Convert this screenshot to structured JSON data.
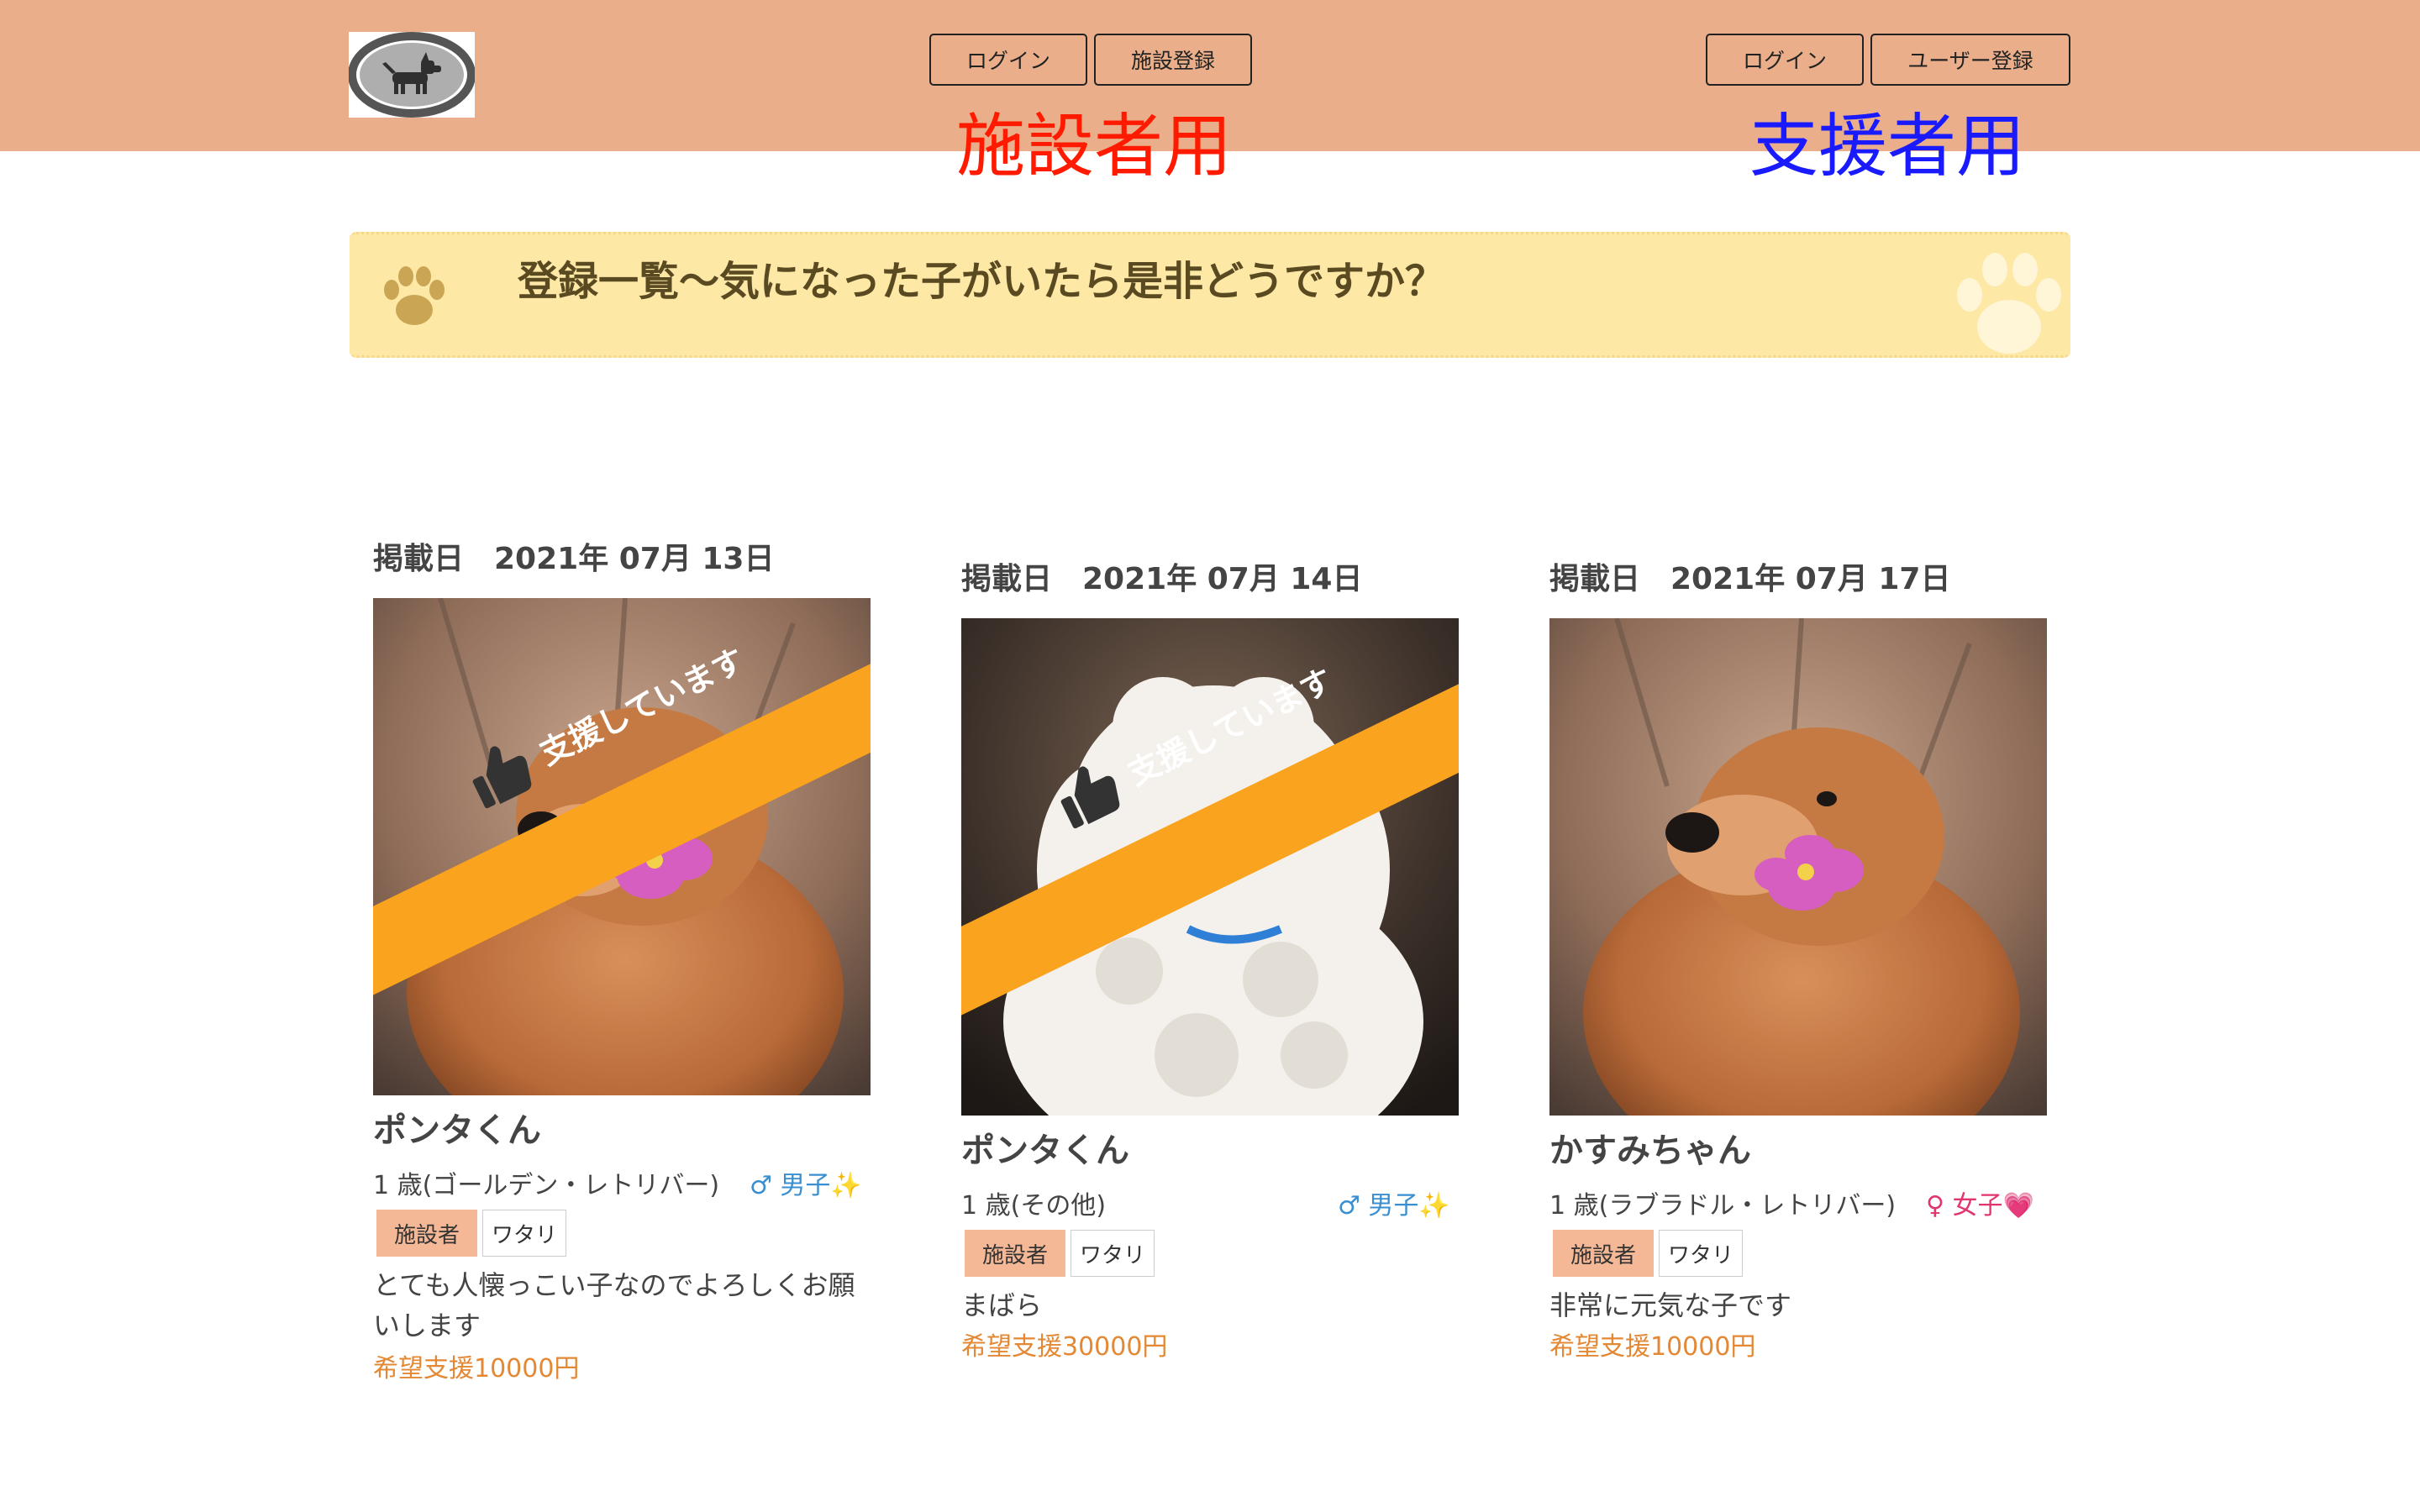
{
  "header": {
    "logo_icon": "dog-icon",
    "facility": {
      "login_label": "ログイン",
      "register_label": "施設登録",
      "section_label": "施設者用",
      "label_color": "#ff1a00"
    },
    "supporter": {
      "login_label": "ログイン",
      "register_label": "ユーザー登録",
      "section_label": "支援者用",
      "label_color": "#1a1aff"
    }
  },
  "banner": {
    "title": "登録一覧〜気になった子がいたら是非どうですか？",
    "icon": "paw-icon"
  },
  "listings": [
    {
      "date": "掲載日　2021年 07月 13日",
      "ribbon": "支援しています",
      "name": "ポンタくん",
      "age_breed": "1 歳(ゴールデン・レトリバー)",
      "gender": "♂ 男子✨",
      "role_tag": "施設者",
      "facility_tag": "ワタリ",
      "description": "とても人懐っこい子なのでよろしくお願いします",
      "support": "希望支援10000円"
    },
    {
      "date": "掲載日　2021年 07月 14日",
      "ribbon": "支援しています",
      "name": "ポンタくん",
      "age_breed": "1 歳(その他)",
      "gender": "♂ 男子✨",
      "role_tag": "施設者",
      "facility_tag": "ワタリ",
      "description": "まばら",
      "support": "希望支援30000円"
    },
    {
      "date": "掲載日　2021年 07月 17日",
      "name": "かすみちゃん",
      "age_breed": "1 歳(ラブラドル・レトリバー)",
      "gender": "♀ 女子💗",
      "role_tag": "施設者",
      "facility_tag": "ワタリ",
      "description": "非常に元気な子です",
      "support": "希望支援10000円"
    }
  ],
  "colors": {
    "header_bg": "#eaaf8a",
    "banner_bg": "#fee8a6",
    "ribbon": "#f9a31e",
    "male": "#3a8fd0",
    "female": "#e0356e",
    "support": "#e38834"
  }
}
